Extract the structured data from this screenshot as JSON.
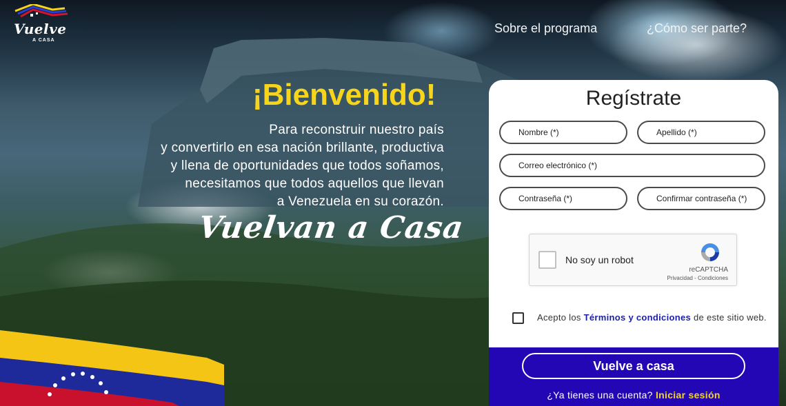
{
  "logo": {
    "title": "Vuelve",
    "subtitle": "A CASA"
  },
  "nav": {
    "about": "Sobre el programa",
    "join": "¿Cómo ser parte?"
  },
  "hero": {
    "welcome": "¡Bienvenido!",
    "intro_lines": [
      "Para reconstruir nuestro país",
      "y convertirlo en esa nación brillante, productiva",
      "y llena de oportunidades que todos soñamos,",
      "necesitamos que todos aquellos que llevan",
      "a Venezuela en su corazón."
    ],
    "slogan": "Vuelvan a Casa"
  },
  "form": {
    "title": "Regístrate",
    "first_name": "Nombre (*)",
    "last_name": "Apellido (*)",
    "email": "Correo electrónico (*)",
    "password": "Contraseña (*)",
    "confirm_password": "Confirmar contraseña (*)",
    "captcha": {
      "label": "No soy un robot",
      "brand": "reCAPTCHA",
      "links": "Privacidad - Condiciones"
    },
    "terms": {
      "prefix": "Acepto los",
      "link": "Términos y condiciones",
      "suffix": "de este sitio web."
    },
    "submit": "Vuelve a casa",
    "account": {
      "question": "¿Ya tienes una cuenta?",
      "login": "Iniciar sesión"
    }
  },
  "colors": {
    "accent_yellow": "#f7d51c",
    "brand_blue": "#2307b4",
    "link_blue": "#1b1fa6"
  }
}
